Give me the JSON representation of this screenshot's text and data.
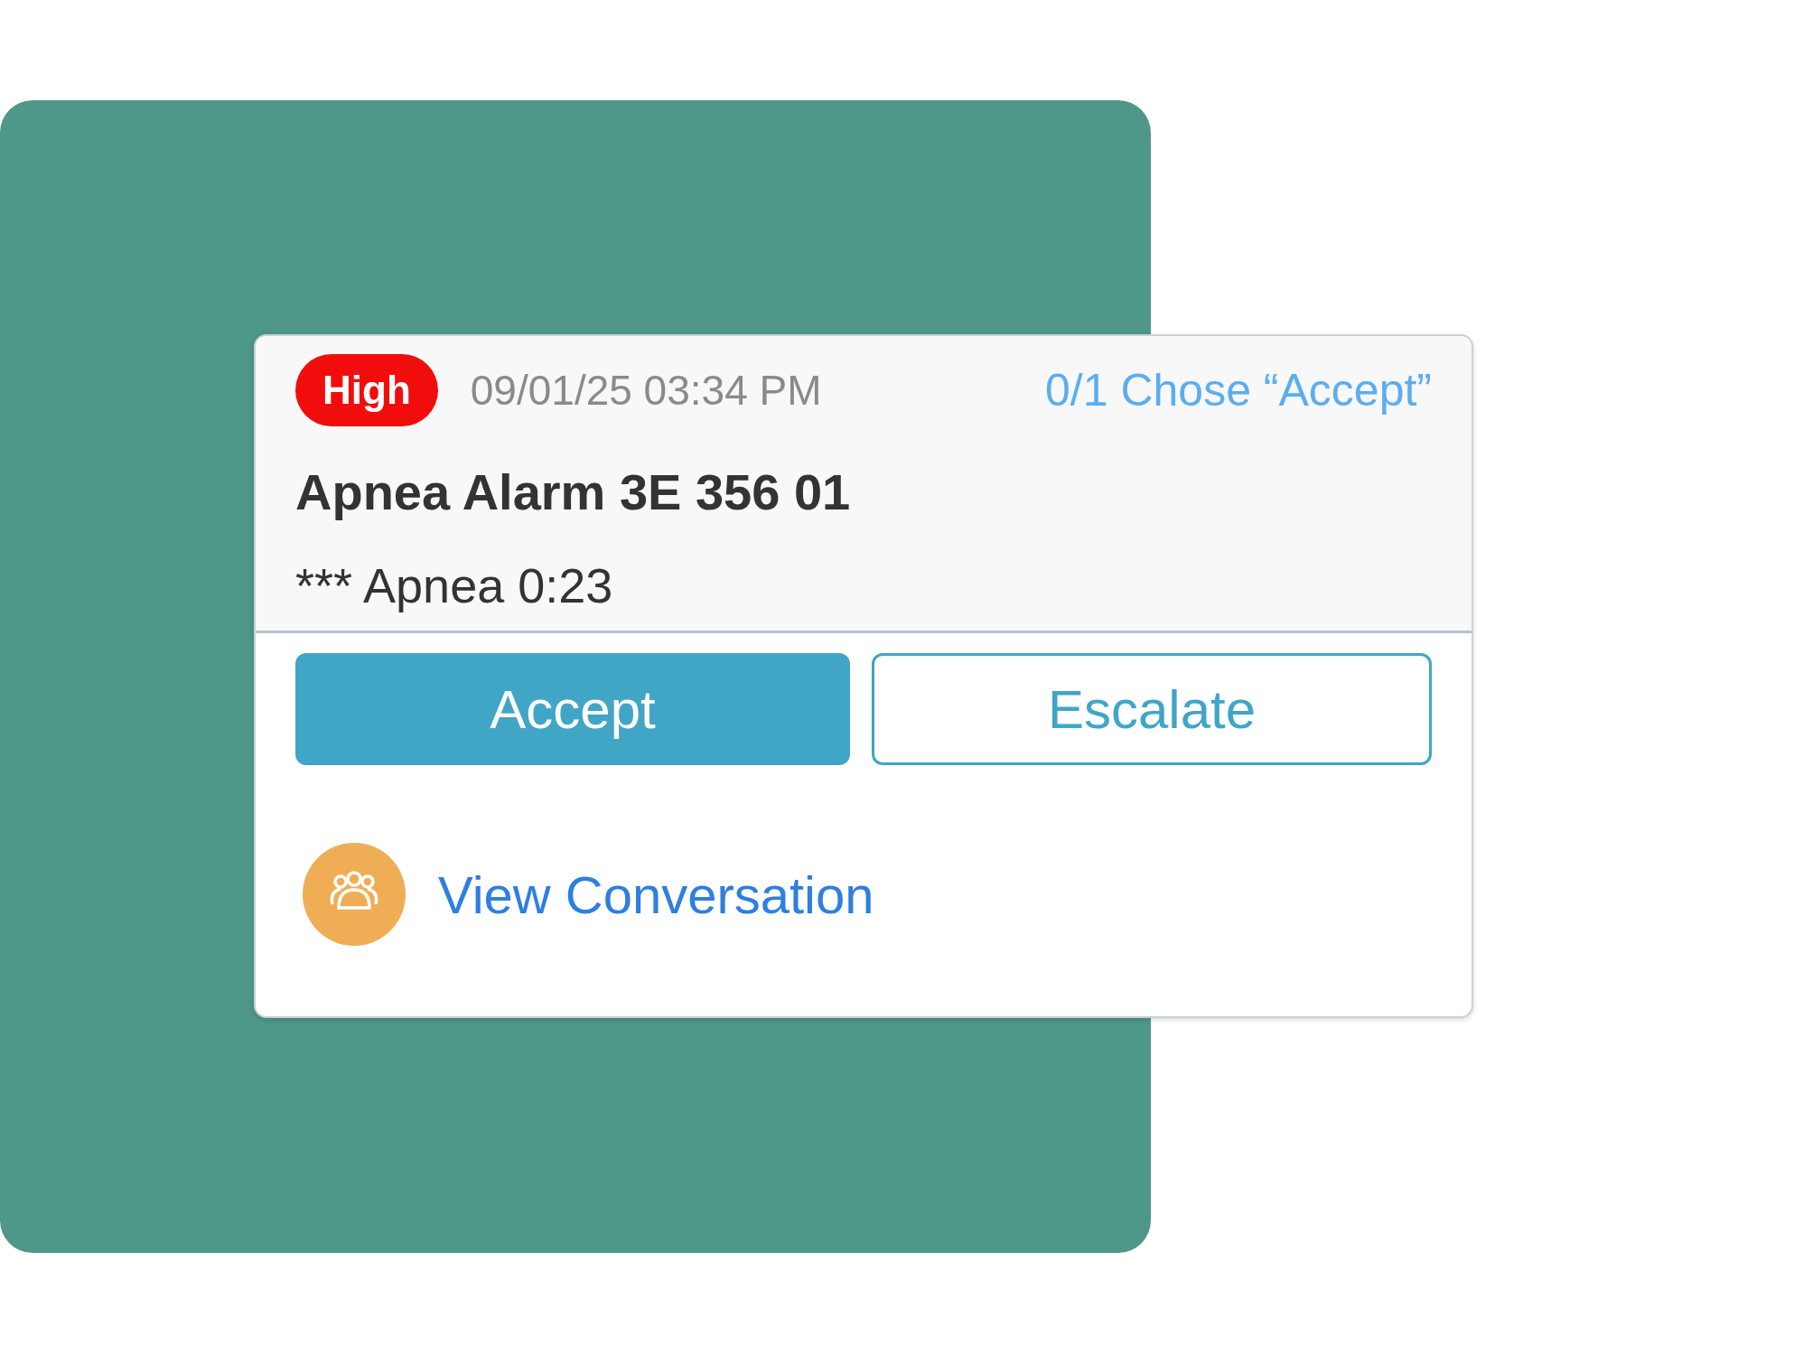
{
  "alert": {
    "priority": "High",
    "timestamp": "09/01/25 03:34 PM",
    "responses": "0/1 Chose “Accept”",
    "title": "Apnea Alarm 3E 356 01",
    "detail": "*** Apnea 0:23"
  },
  "buttons": [
    {
      "label": "Accept",
      "kind": "primary"
    },
    {
      "label": "Escalate",
      "kind": "outline"
    }
  ],
  "conversation_link": "View Conversation"
}
